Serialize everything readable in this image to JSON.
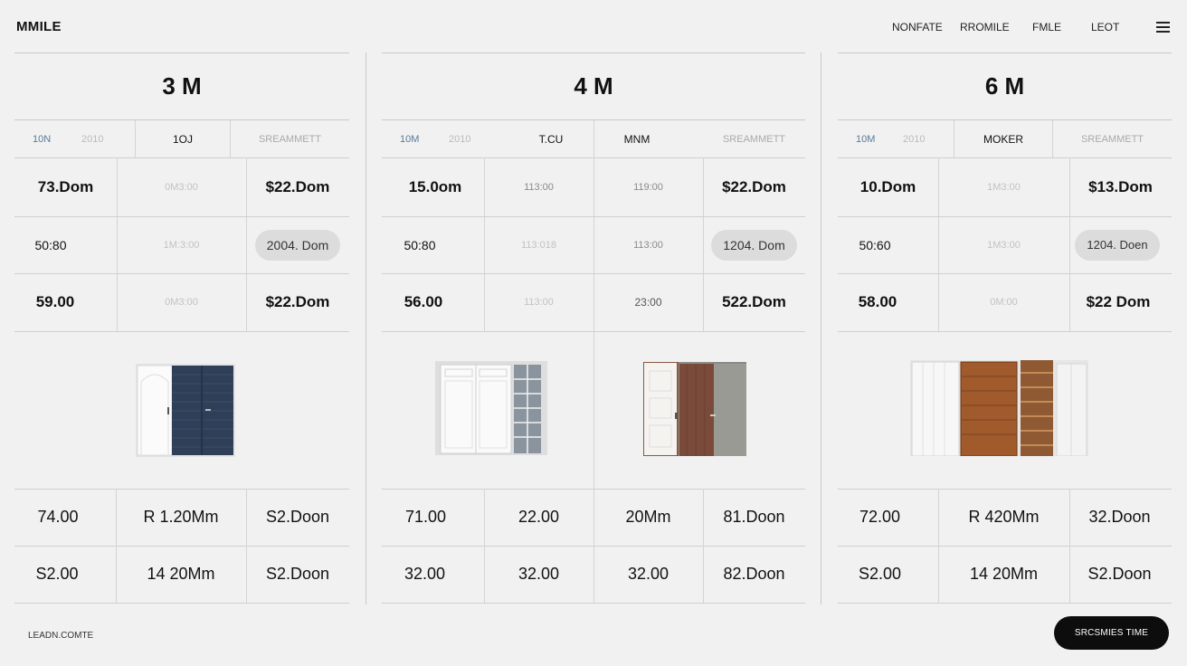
{
  "header": {
    "brand": "MMILE",
    "nav": [
      "NONFATE",
      "RROMILE",
      "FMLE",
      "LEOT"
    ]
  },
  "footer": {
    "link": "LEADN.COMTE",
    "cta": "SRCSMIES TIME"
  },
  "columns": [
    {
      "title": "3 M",
      "sub": [
        "10N",
        "2010",
        "1OJ",
        "SREAMMETT"
      ],
      "rows": [
        [
          "73.Dom",
          "0M3:00",
          "$22.Dom"
        ],
        [
          "50:80",
          "1M:3:00",
          "2004. Dom"
        ],
        [
          "59.00",
          "0M3:00",
          "$22.Dom"
        ]
      ],
      "bottom": [
        [
          "74.00",
          "R 1.20Mm",
          "S2.Doon"
        ],
        [
          "S2.00",
          "14 20Mm",
          "S2.Doon"
        ]
      ]
    },
    {
      "title": "4 M",
      "sub": [
        "10M",
        "2010",
        "T.CU",
        "MNM",
        "SREAMMETT"
      ],
      "rows": [
        [
          "15.0om",
          "113:00",
          "119:00",
          "$22.Dom"
        ],
        [
          "50:80",
          "113:018",
          "113:00",
          "1204. Dom"
        ],
        [
          "56.00",
          "113:00",
          "23:00",
          "522.Dom"
        ]
      ],
      "bottom": [
        [
          "71.00",
          "22.00",
          "20Mm",
          "81.Doon"
        ],
        [
          "32.00",
          "32.00",
          "32.00",
          "82.Doon"
        ]
      ]
    },
    {
      "title": "6 M",
      "sub": [
        "10M",
        "2010",
        "MOKER",
        "SREAMMETT"
      ],
      "rows": [
        [
          "10.Dom",
          "1M3:00",
          "$13.Dom"
        ],
        [
          "50:60",
          "1M3:00",
          "1204. Doen"
        ],
        [
          "58.00",
          "0M:00",
          "$22 Dom"
        ]
      ],
      "bottom": [
        [
          "72.00",
          "R 420Mm",
          "32.Doon"
        ],
        [
          "S2.00",
          "14 20Mm",
          "S2.Doon"
        ]
      ]
    }
  ]
}
